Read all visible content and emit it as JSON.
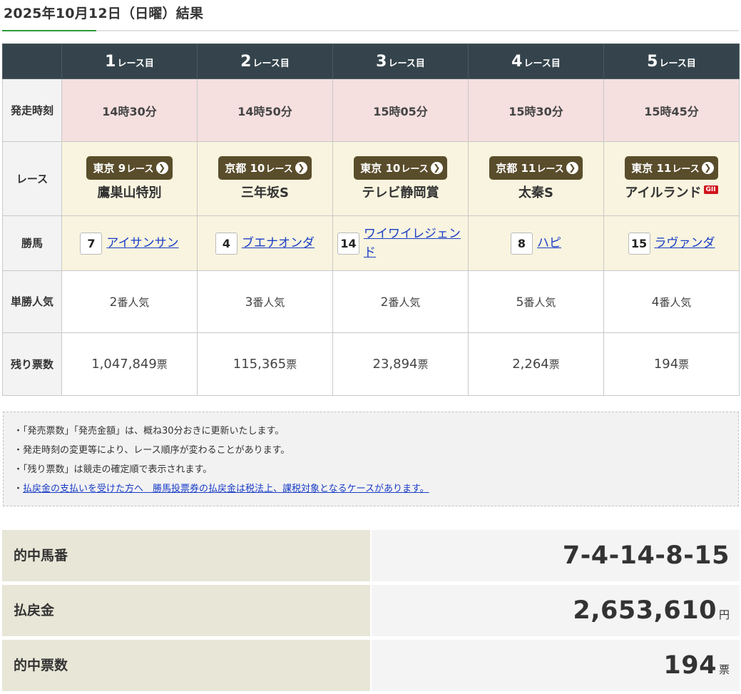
{
  "title": "2025年10月12日（日曜）結果",
  "races": [
    {
      "num": "1",
      "suffix": "レース目",
      "time": "14時30分",
      "course": "東京",
      "race_no": "9",
      "race_unit": "レース",
      "name": "鷹巣山特別",
      "grade": "",
      "horse_num": "7",
      "horse": "アイサンサン",
      "pop_num": "2",
      "pop_suffix": "番人気",
      "left": "1,047,849",
      "left_unit": "票"
    },
    {
      "num": "2",
      "suffix": "レース目",
      "time": "14時50分",
      "course": "京都",
      "race_no": "10",
      "race_unit": "レース",
      "name": "三年坂S",
      "grade": "",
      "horse_num": "4",
      "horse": "ブエナオンダ",
      "pop_num": "3",
      "pop_suffix": "番人気",
      "left": "115,365",
      "left_unit": "票"
    },
    {
      "num": "3",
      "suffix": "レース目",
      "time": "15時05分",
      "course": "東京",
      "race_no": "10",
      "race_unit": "レース",
      "name": "テレビ静岡賞",
      "grade": "",
      "horse_num": "14",
      "horse": "ワイワイレジェンド",
      "pop_num": "2",
      "pop_suffix": "番人気",
      "left": "23,894",
      "left_unit": "票"
    },
    {
      "num": "4",
      "suffix": "レース目",
      "time": "15時30分",
      "course": "京都",
      "race_no": "11",
      "race_unit": "レース",
      "name": "太秦S",
      "grade": "",
      "horse_num": "8",
      "horse": "ハピ",
      "pop_num": "5",
      "pop_suffix": "番人気",
      "left": "2,264",
      "left_unit": "票"
    },
    {
      "num": "5",
      "suffix": "レース目",
      "time": "15時45分",
      "course": "東京",
      "race_no": "11",
      "race_unit": "レース",
      "name": "アイルランド",
      "grade": "GII",
      "horse_num": "15",
      "horse": "ラヴァンダ",
      "pop_num": "4",
      "pop_suffix": "番人気",
      "left": "194",
      "left_unit": "票"
    }
  ],
  "row_labels": {
    "time": "発走時刻",
    "race": "レース",
    "winner": "勝馬",
    "popularity": "単勝人気",
    "remaining": "残り票数"
  },
  "notes": [
    "・「発売票数」「発売金額」は、概ね30分おきに更新いたします。",
    "・発走時刻の変更等により、レース順序が変わることがあります。",
    "・「残り票数」は競走の確定順で表示されます。"
  ],
  "notes_link": {
    "bullet": "・",
    "text": "払戻金の支払いを受けた方へ　勝馬投票券の払戻金は税法上、課税対象となるケースがあります。"
  },
  "summary": {
    "winning_label": "的中馬番",
    "winning_value": "7-4-14-8-15",
    "payout_label": "払戻金",
    "payout_value": "2,653,610",
    "payout_unit": "円",
    "tickets_label": "的中票数",
    "tickets_value": "194",
    "tickets_unit": "票"
  },
  "colors": {
    "header_bg": "#35444c",
    "time_row": "#f5dfdf",
    "race_row": "#f8f4df",
    "badge": "#5a4d2b",
    "accent_green": "#2c9c3c",
    "link": "#1a3dc6"
  }
}
